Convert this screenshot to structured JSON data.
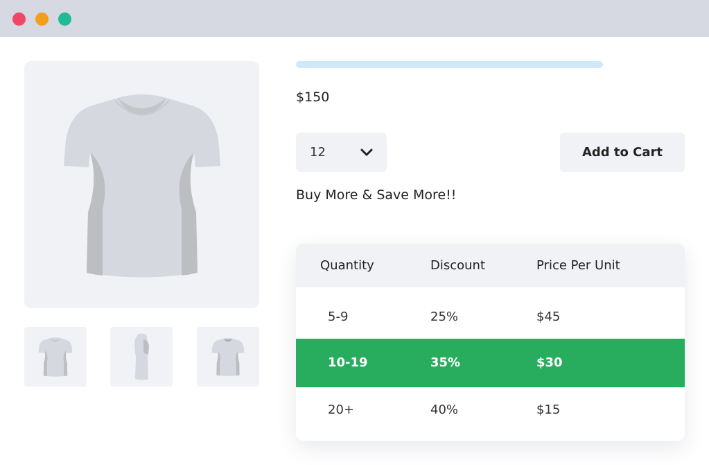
{
  "window": {
    "controls": [
      "close",
      "minimize",
      "maximize"
    ],
    "colors": {
      "close": "#ef4765",
      "minimize": "#f59e1b",
      "maximize": "#20bb94",
      "titlebar": "#d6d9e1"
    }
  },
  "product": {
    "title_placeholder_color": "#cfe9fb",
    "price": "$150",
    "images": {
      "main": "tshirt-front-icon",
      "thumbnails": [
        "tshirt-front-icon",
        "tshirt-side-icon",
        "tshirt-back-icon"
      ]
    }
  },
  "quantity_select": {
    "value": "12",
    "icon": "chevron-down-icon"
  },
  "add_to_cart": {
    "label": "Add to Cart"
  },
  "promo_text": "Buy More & Save More!!",
  "discount_table": {
    "headers": [
      "Quantity",
      "Discount",
      "Price Per Unit"
    ],
    "rows": [
      [
        "5-9",
        "25%",
        "$45"
      ],
      [
        "10-19",
        "35%",
        "$30"
      ],
      [
        "20+",
        "40%",
        "$15"
      ]
    ],
    "highlight_row": 1,
    "highlight_color": "#28ad5f"
  }
}
